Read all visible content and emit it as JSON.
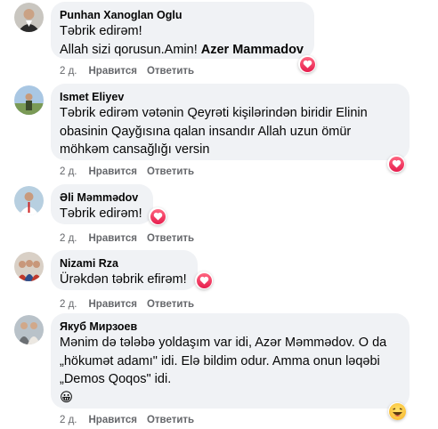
{
  "comments": [
    {
      "author": "Punhan Xanoglan Oglu",
      "lines": [
        "Təbrik edirəm!",
        "Allah sizi qorusun.Amin! "
      ],
      "bold_tail": "Azer Mammadov",
      "time": "2 д.",
      "like_label": "Нравится",
      "reply_label": "Ответить",
      "reaction": "heart-icon"
    },
    {
      "author": "Ismet Eliyev",
      "lines": [
        "Təbrik edirəm vətənin Qeyrəti kişilərindən biridir Elinin",
        "obasinin Qayğısına qalan insandır Allah uzun ömür",
        "möhkəm cansağlığı versin"
      ],
      "time": "2 д.",
      "like_label": "Нравится",
      "reply_label": "Ответить",
      "reaction": "heart-icon"
    },
    {
      "author": "Əli Məmmədov",
      "lines": [
        "Təbrik edirəm!"
      ],
      "time": "2 д.",
      "like_label": "Нравится",
      "reply_label": "Ответить",
      "reaction": "heart-icon"
    },
    {
      "author": "Nizami Rza",
      "lines": [
        "Ürəkdən təbrik efirəm!"
      ],
      "time": "2 д.",
      "like_label": "Нравится",
      "reply_label": "Ответить",
      "reaction": "heart-icon"
    },
    {
      "author": "Якуб Мирзоев",
      "lines": [
        "Mənim də tələbə yoldaşım var idi, Azər Məmmədov. O da",
        "„hökumət adamı\" idi. Elə bildim odur. Amma onun ləqəbi",
        "„Demos Qoqos\" idi."
      ],
      "emoji": "😀",
      "time": "2 д.",
      "like_label": "Нравится",
      "reply_label": "Ответить",
      "reaction": "laughing-face-icon"
    }
  ],
  "colors": {
    "bubble": "#f0f2f5",
    "meta": "#65676b",
    "heart": "#f33e58",
    "laugh": "#f7b125"
  }
}
